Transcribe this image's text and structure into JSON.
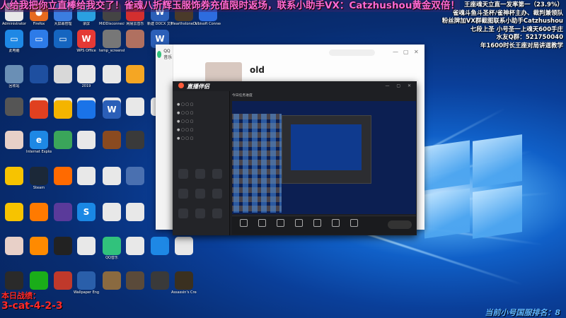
{
  "banner": {
    "text": "人给我把你立直棒给我交了！雀魂八折辉玉服饰券充值限时返场，联系小助手VX：Catzhushou黄金双倍！！"
  },
  "overlay_right": [
    "王座魂天立直一发率第一（23.9%）",
    "雀魂斗鱼斗圣杯/雀神杯主办、裁判兼领队",
    "粉丝牌加VX群截图联系小助手Catzhushou",
    "七段上圣 小号圣一上魂天600手庄",
    "水友Q群：521750040",
    "年1600时长王座对局讲道教学"
  ],
  "bottom_left": {
    "line1": "本日战绩：",
    "line2": "3-cat-4-2-3"
  },
  "bottom_right": "当前小号国服排名：8",
  "desktop_icons": [
    {
      "label": "Administrator",
      "color": "#e8e8e8",
      "glyph": "",
      "col": 0,
      "row": 0
    },
    {
      "label": "Firefox",
      "color": "#e66a1f",
      "glyph": "●",
      "col": 1,
      "row": 0
    },
    {
      "label": "大屏幕管理",
      "color": "#3b7de0",
      "glyph": "",
      "col": 2,
      "row": 0
    },
    {
      "label": "录屏",
      "color": "#2aa0e0",
      "glyph": "",
      "col": 3,
      "row": 0
    },
    {
      "label": "MiDDisconnector",
      "color": "#444",
      "glyph": "",
      "col": 4,
      "row": 0
    },
    {
      "label": "网易云音乐",
      "color": "#d32f2f",
      "glyph": "",
      "col": 5,
      "row": 0
    },
    {
      "label": "新建 DOCX 文档",
      "color": "#2b5fb8",
      "glyph": "W",
      "col": 6,
      "row": 0
    },
    {
      "label": "HearthstoneDeckTracker",
      "color": "#4a3a2a",
      "glyph": "",
      "col": 7,
      "row": 0
    },
    {
      "label": "Ubisoft Connect",
      "color": "#2d6cdf",
      "glyph": "",
      "col": 8,
      "row": 0
    },
    {
      "label": "此电脑",
      "color": "#1e88e5",
      "glyph": "▭",
      "col": 0,
      "row": 1
    },
    {
      "label": "",
      "color": "#2d7be8",
      "glyph": "▭",
      "col": 1,
      "row": 1
    },
    {
      "label": "",
      "color": "#1565c0",
      "glyph": "▭",
      "col": 2,
      "row": 1
    },
    {
      "label": "WPS Office",
      "color": "#e53935",
      "glyph": "W",
      "col": 3,
      "row": 1
    },
    {
      "label": "temp_screenshot",
      "color": "#777",
      "glyph": "",
      "col": 4,
      "row": 1
    },
    {
      "label": "",
      "color": "#b07060",
      "glyph": "",
      "col": 5,
      "row": 1
    },
    {
      "label": "",
      "color": "#2b5fb8",
      "glyph": "W",
      "col": 6,
      "row": 1
    },
    {
      "label": "回收站",
      "color": "#6a8fb5",
      "glyph": "",
      "col": 0,
      "row": 2
    },
    {
      "label": "",
      "color": "#1e4fa0",
      "glyph": "",
      "col": 1,
      "row": 2
    },
    {
      "label": "",
      "color": "#d8d8d8",
      "glyph": "",
      "col": 2,
      "row": 2
    },
    {
      "label": "2019",
      "color": "#e8e8e8",
      "glyph": "",
      "col": 3,
      "row": 2
    },
    {
      "label": "",
      "color": "#e8e8e8",
      "glyph": "",
      "col": 4,
      "row": 2
    },
    {
      "label": "",
      "color": "#f5a623",
      "glyph": "",
      "col": 5,
      "row": 2
    },
    {
      "label": "",
      "color": "#555",
      "glyph": "",
      "col": 0,
      "row": 3
    },
    {
      "label": "",
      "color": "#e8e8e8",
      "glyph": "",
      "col": 1,
      "row": 3
    },
    {
      "label": "",
      "color": "#e8e8e8",
      "glyph": "",
      "col": 2,
      "row": 3
    },
    {
      "label": "",
      "color": "#e8e8e8",
      "glyph": "",
      "col": 3,
      "row": 3
    },
    {
      "label": "",
      "color": "#e8e8e8",
      "glyph": "",
      "col": 4,
      "row": 3
    },
    {
      "label": "",
      "color": "#e8e8e8",
      "glyph": "",
      "col": 5,
      "row": 3
    },
    {
      "label": "",
      "color": "#f0f0f0",
      "glyph": "",
      "col": 6,
      "row": 3
    },
    {
      "label": "",
      "color": "#e04020",
      "glyph": "",
      "col": 1,
      "row": 4
    },
    {
      "label": "",
      "color": "#f4b400",
      "glyph": "",
      "col": 2,
      "row": 4
    },
    {
      "label": "",
      "color": "#1a73e8",
      "glyph": "",
      "col": 3,
      "row": 4
    },
    {
      "label": "",
      "color": "#2b5fb8",
      "glyph": "W",
      "col": 4,
      "row": 4
    },
    {
      "label": "",
      "color": "#e8d0c8",
      "glyph": "",
      "col": 0,
      "row": 5
    },
    {
      "label": "Internet Explorer",
      "color": "#1e88e5",
      "glyph": "e",
      "col": 1,
      "row": 5
    },
    {
      "label": "",
      "color": "#3aa55a",
      "glyph": "",
      "col": 2,
      "row": 5
    },
    {
      "label": "",
      "color": "#e8e8e8",
      "glyph": "",
      "col": 3,
      "row": 5
    },
    {
      "label": "",
      "color": "#8a4a20",
      "glyph": "",
      "col": 4,
      "row": 5
    },
    {
      "label": "",
      "color": "#3a3a3a",
      "glyph": "",
      "col": 5,
      "row": 5
    },
    {
      "label": "",
      "color": "#f7c300",
      "glyph": "",
      "col": 0,
      "row": 6
    },
    {
      "label": "Steam",
      "color": "#1b2838",
      "glyph": "",
      "col": 1,
      "row": 6
    },
    {
      "label": "",
      "color": "#ff6a00",
      "glyph": "",
      "col": 2,
      "row": 6
    },
    {
      "label": "",
      "color": "#e8e8e8",
      "glyph": "",
      "col": 3,
      "row": 6
    },
    {
      "label": "",
      "color": "#e8e8e8",
      "glyph": "",
      "col": 4,
      "row": 6
    },
    {
      "label": "",
      "color": "#4a70b0",
      "glyph": "",
      "col": 5,
      "row": 6
    },
    {
      "label": "",
      "color": "#f7c300",
      "glyph": "",
      "col": 0,
      "row": 7
    },
    {
      "label": "",
      "color": "#ff7a00",
      "glyph": "",
      "col": 1,
      "row": 7
    },
    {
      "label": "",
      "color": "#5a3a9a",
      "glyph": "",
      "col": 2,
      "row": 7
    },
    {
      "label": "",
      "color": "#1a88e5",
      "glyph": "S",
      "col": 3,
      "row": 7
    },
    {
      "label": "",
      "color": "#e8e8e8",
      "glyph": "",
      "col": 4,
      "row": 7
    },
    {
      "label": "",
      "color": "#e8e8e8",
      "glyph": "",
      "col": 5,
      "row": 7
    },
    {
      "label": "",
      "color": "#e8d0c8",
      "glyph": "",
      "col": 0,
      "row": 8
    },
    {
      "label": "",
      "color": "#ff8a00",
      "glyph": "",
      "col": 1,
      "row": 8
    },
    {
      "label": "",
      "color": "#222",
      "glyph": "",
      "col": 2,
      "row": 8
    },
    {
      "label": "",
      "color": "#e8e8e8",
      "glyph": "",
      "col": 3,
      "row": 8
    },
    {
      "label": "QQ音乐",
      "color": "#31c27c",
      "glyph": "",
      "col": 4,
      "row": 8
    },
    {
      "label": "",
      "color": "#e8e8e8",
      "glyph": "",
      "col": 5,
      "row": 8
    },
    {
      "label": "",
      "color": "#1e88e5",
      "glyph": "",
      "col": 6,
      "row": 8
    },
    {
      "label": "",
      "color": "#e8e8e8",
      "glyph": "",
      "col": 7,
      "row": 8
    },
    {
      "label": "",
      "color": "#2a2a2a",
      "glyph": "",
      "col": 0,
      "row": 9
    },
    {
      "label": "",
      "color": "#1aad19",
      "glyph": "",
      "col": 1,
      "row": 9
    },
    {
      "label": "",
      "color": "#c0392b",
      "glyph": "",
      "col": 2,
      "row": 9
    },
    {
      "label": "Wallpaper Engine",
      "color": "#2a5faa",
      "glyph": "",
      "col": 3,
      "row": 9
    },
    {
      "label": "",
      "color": "#8a6a40",
      "glyph": "",
      "col": 4,
      "row": 9
    },
    {
      "label": "",
      "color": "#5a4a3a",
      "glyph": "",
      "col": 5,
      "row": 9
    },
    {
      "label": "",
      "color": "#3a3a3a",
      "glyph": "",
      "col": 6,
      "row": 9
    },
    {
      "label": "Assassin's Creed Odyssey",
      "color": "#3a3020",
      "glyph": "",
      "col": 7,
      "row": 9
    }
  ],
  "qq_music": {
    "app_name": "QQ音乐",
    "title": "old",
    "search_placeholder": "",
    "menu": [
      "",
      "",
      "",
      "",
      "",
      ""
    ]
  },
  "live_tool": {
    "title": "直播伴侣",
    "top_text": "今日任务进度",
    "sources": [
      "",
      "",
      "",
      "",
      ""
    ],
    "hint": "",
    "tools": [
      "",
      "",
      "",
      "",
      "",
      "",
      ""
    ],
    "start_label": ""
  }
}
